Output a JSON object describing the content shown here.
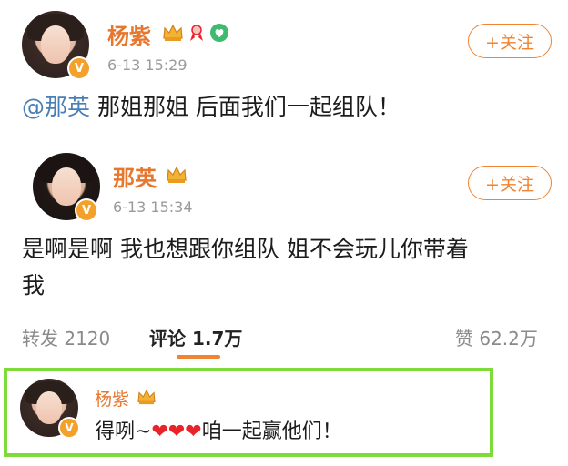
{
  "post": {
    "author": "杨紫",
    "time": "6-13 15:29",
    "follow_label": "+关注",
    "mention": "@那英",
    "text": " 那姐那姐 后面我们一起组队！"
  },
  "reply_post": {
    "author": "那英",
    "time": "6-13 15:34",
    "follow_label": "+关注",
    "text_line1": "是啊是啊 我也想跟你组队 姐不会玩儿你带着",
    "text_line2": "我"
  },
  "stats": {
    "repost_label": "转发",
    "repost_count": "2120",
    "comment_label": "评论",
    "comment_count": "1.7万",
    "like_label": "赞",
    "like_count": "62.2万"
  },
  "comment": {
    "author": "杨紫",
    "text_before": "得咧~",
    "hearts": "❤❤❤",
    "text_after": "咱一起赢他们！"
  },
  "colors": {
    "name": "#e8772e",
    "follow": "#f08433",
    "mention": "#4a7fb5",
    "highlight": "#7ddc3a",
    "tab_underline": "#f08433"
  },
  "icons": [
    "crown-icon",
    "ribbon-icon",
    "heart-badge-icon",
    "verified-icon"
  ]
}
